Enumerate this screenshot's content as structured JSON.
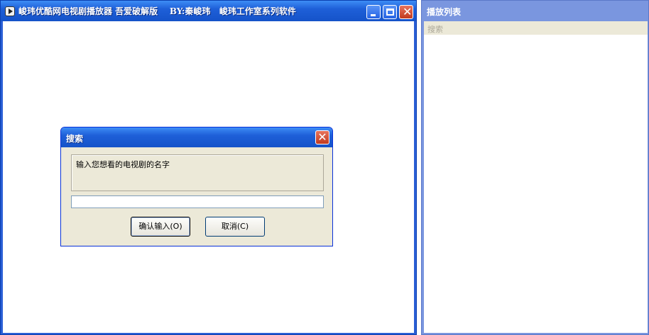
{
  "main_window": {
    "title": "峻玮优酷网电视剧播放器 吾爱破解版    BY:秦峻玮   峻玮工作室系列软件",
    "minimize": "minimize-button",
    "maximize": "maximize-button",
    "close": "close-button"
  },
  "playlist_window": {
    "title": "播放列表",
    "search_placeholder": "搜索"
  },
  "dialog": {
    "title": "搜索",
    "prompt": "输入您想看的电视剧的名字",
    "input_value": "",
    "ok_label": "确认输入(O)",
    "cancel_label": "取消(C)"
  },
  "colors": {
    "xp_blue": "#1e5fd8",
    "dialog_bg": "#ece9d8",
    "close_red": "#c23a1e",
    "inactive_title": "#7a96df"
  },
  "icons": [
    "app-icon",
    "minimize-icon",
    "maximize-icon",
    "close-icon"
  ]
}
